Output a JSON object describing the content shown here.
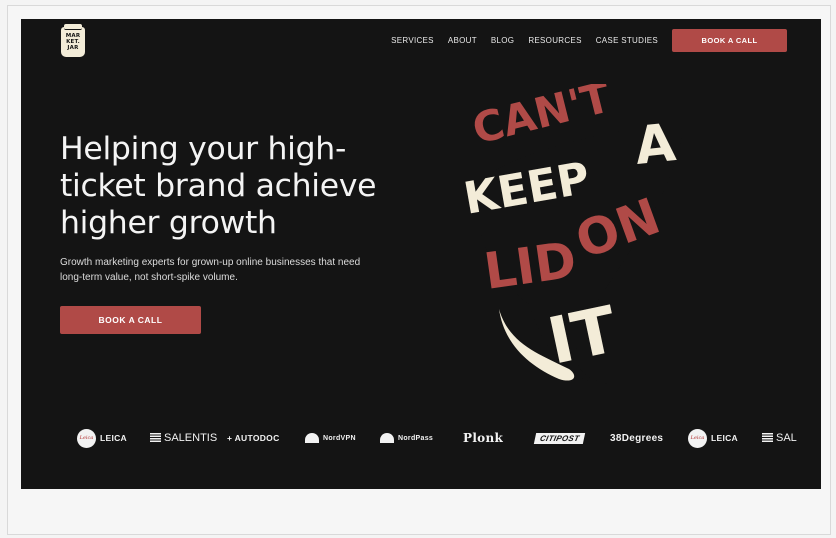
{
  "header": {
    "logo_lines": [
      "MAR",
      "KET.",
      "JAR"
    ],
    "nav": [
      "SERVICES",
      "ABOUT",
      "BLOG",
      "RESOURCES",
      "CASE STUDIES"
    ],
    "cta": "BOOK A CALL"
  },
  "hero": {
    "title": "Helping your high-ticket brand achieve higher growth",
    "subtitle": "Growth marketing experts for grown-up online businesses that need long-term value, not short-spike volume.",
    "cta": "BOOK A CALL",
    "art_words": [
      "CAN'T",
      "KEEP",
      "A",
      "LID",
      "ON",
      "IT"
    ]
  },
  "logos": [
    "LEICA",
    "SALENTIS",
    "+ AUTODOC",
    "NordVPN",
    "NordPass",
    "Plonk",
    "CITIPOST",
    "38Degrees",
    "LEICA",
    "SAL"
  ],
  "colors": {
    "background": "#141414",
    "accent": "#b04a47",
    "cream": "#f3ecd8",
    "text": "#f4f4f4"
  },
  "icons": [
    "marketjar-logo-icon",
    "leica-icon",
    "salentis-icon",
    "nordvpn-icon",
    "nordpass-icon"
  ]
}
